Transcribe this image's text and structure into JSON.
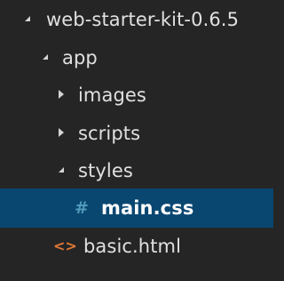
{
  "explorer": {
    "root": {
      "label": "web-starter-kit-0.6.5",
      "state": "expanded"
    },
    "app": {
      "label": "app",
      "state": "expanded"
    },
    "images": {
      "label": "images",
      "state": "collapsed"
    },
    "scripts": {
      "label": "scripts",
      "state": "collapsed"
    },
    "styles": {
      "label": "styles",
      "state": "expanded"
    },
    "main_css": {
      "label": "main.css",
      "icon": "css-file-icon",
      "icon_glyph": "#",
      "selected": true
    },
    "basic_html": {
      "label": "basic.html",
      "icon": "html-file-icon",
      "icon_glyph": "<>"
    }
  },
  "colors": {
    "background": "#252526",
    "selection": "#094771",
    "text": "#e0e0e0",
    "css_icon": "#519aba",
    "html_icon": "#e37933"
  }
}
